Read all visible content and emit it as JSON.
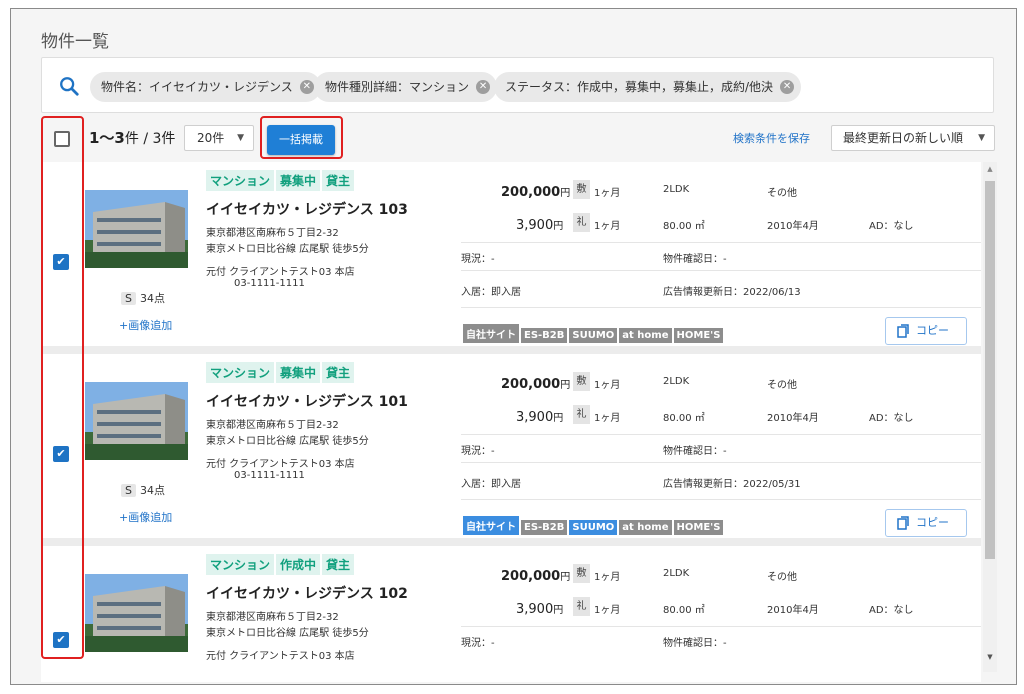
{
  "page_title": "物件一覧",
  "search": {
    "chips": [
      {
        "label": "物件名：イイセイカツ・レジデンス"
      },
      {
        "label": "物件種別詳細：マンション"
      },
      {
        "label": "ステータス：作成中，募集中，募集止，成約/他決"
      }
    ]
  },
  "toolbar": {
    "count_range": "1〜3",
    "count_unit": "件",
    "count_total": " / 3件",
    "per_page": "20件",
    "bulk_publish_label": "一括掲載",
    "save_search_label": "検索条件を保存",
    "sort_label": "最終更新日の新しい順"
  },
  "properties": [
    {
      "checked": true,
      "type_tag": "マンション",
      "status_tag": "募集中",
      "role_tag": "貸主",
      "name": "イイセイカツ・レジデンス 103",
      "address": "東京都港区南麻布５丁目2-32",
      "access": "東京メトロ日比谷線 広尾駅 徒歩5分",
      "agent": "元付  クライアントテスト03 本店",
      "phone": "03-1111-1111",
      "score_badge": "S",
      "score": "34点",
      "add_image": "+画像追加",
      "rent": "200,000",
      "yen": "円",
      "mgmt_fee": "3,900",
      "deposit_label": "敷",
      "deposit": "1ヶ月",
      "key_label": "礼",
      "key_money": "1ヶ月",
      "layout": "2LDK",
      "area": "80.00 ㎡",
      "other": "その他",
      "built": "2010年4月",
      "ad": "AD：なし",
      "current": "現況：-",
      "confirm_date": "物件確認日：-",
      "move_in": "入居：即入居",
      "ad_updated": "広告情報更新日：2022/06/13",
      "portals": [
        {
          "label": "自社サイト",
          "active": false
        },
        {
          "label": "ES-B2B",
          "active": false
        },
        {
          "label": "SUUMO",
          "active": false
        },
        {
          "label": "at home",
          "active": false
        },
        {
          "label": "HOME'S",
          "active": false
        }
      ],
      "copy_label": "コピー"
    },
    {
      "checked": true,
      "type_tag": "マンション",
      "status_tag": "募集中",
      "role_tag": "貸主",
      "name": "イイセイカツ・レジデンス 101",
      "address": "東京都港区南麻布５丁目2-32",
      "access": "東京メトロ日比谷線 広尾駅 徒歩5分",
      "agent": "元付  クライアントテスト03 本店",
      "phone": "03-1111-1111",
      "score_badge": "S",
      "score": "34点",
      "add_image": "+画像追加",
      "rent": "200,000",
      "yen": "円",
      "mgmt_fee": "3,900",
      "deposit_label": "敷",
      "deposit": "1ヶ月",
      "key_label": "礼",
      "key_money": "1ヶ月",
      "layout": "2LDK",
      "area": "80.00 ㎡",
      "other": "その他",
      "built": "2010年4月",
      "ad": "AD：なし",
      "current": "現況：-",
      "confirm_date": "物件確認日：-",
      "move_in": "入居：即入居",
      "ad_updated": "広告情報更新日：2022/05/31",
      "portals": [
        {
          "label": "自社サイト",
          "active": true
        },
        {
          "label": "ES-B2B",
          "active": false
        },
        {
          "label": "SUUMO",
          "active": true
        },
        {
          "label": "at home",
          "active": false
        },
        {
          "label": "HOME'S",
          "active": false
        }
      ],
      "copy_label": "コピー"
    },
    {
      "checked": true,
      "type_tag": "マンション",
      "status_tag": "作成中",
      "role_tag": "貸主",
      "name": "イイセイカツ・レジデンス 102",
      "address": "東京都港区南麻布５丁目2-32",
      "access": "東京メトロ日比谷線 広尾駅 徒歩5分",
      "agent": "元付  クライアントテスト03 本店",
      "rent": "200,000",
      "yen": "円",
      "mgmt_fee": "3,900",
      "deposit_label": "敷",
      "deposit": "1ヶ月",
      "key_label": "礼",
      "key_money": "1ヶ月",
      "layout": "2LDK",
      "area": "80.00 ㎡",
      "other": "その他",
      "built": "2010年4月",
      "ad": "AD：なし",
      "current": "現況：-",
      "confirm_date": "物件確認日：-"
    }
  ],
  "colors": {
    "accent": "#1f7fd6",
    "highlight": "#e02020",
    "tag_text": "#12a07e",
    "tag_bg": "#dff3ee",
    "portal_active": "#3b8de0",
    "portal_inactive": "#8d8d8d"
  },
  "icons": {
    "search": "search-icon",
    "chip_remove": "close-circle-icon",
    "copy": "copy-icon",
    "check": "check-icon"
  }
}
